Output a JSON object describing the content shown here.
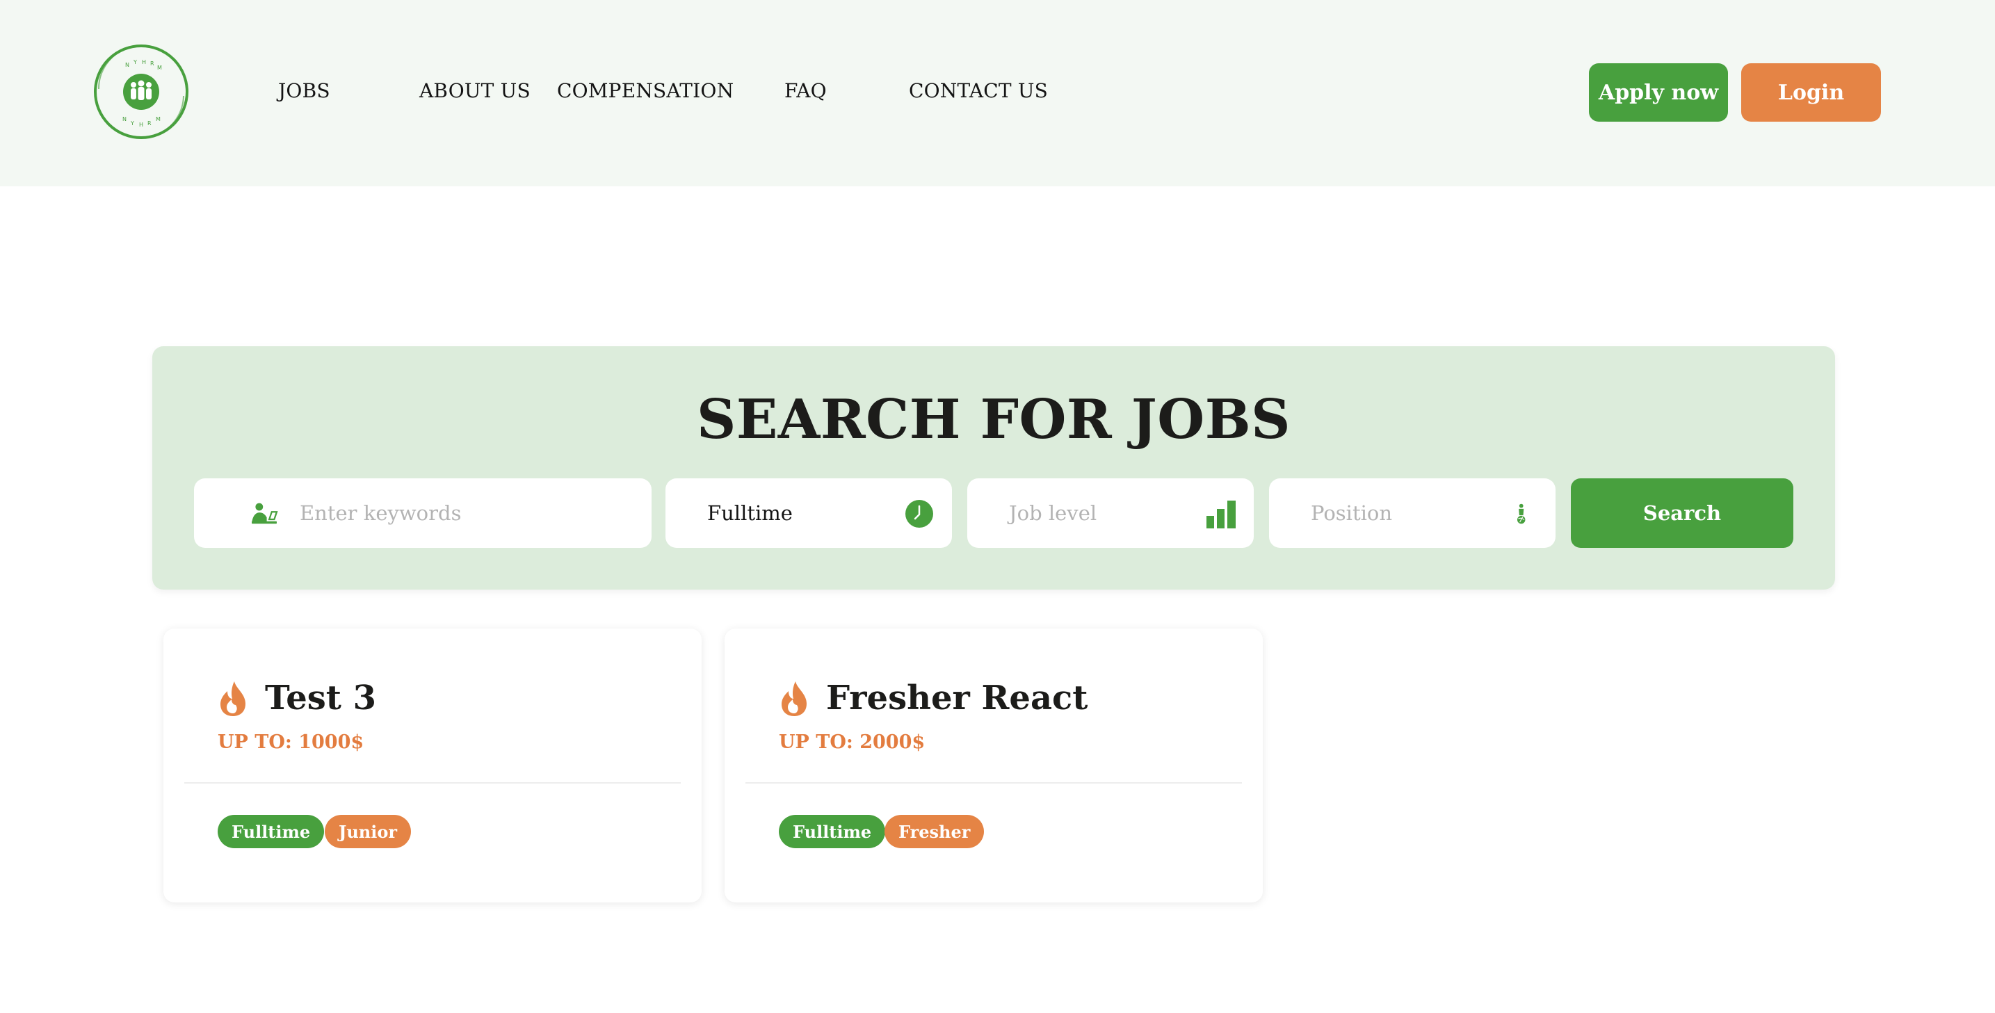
{
  "header": {
    "nav": [
      {
        "label": "JOBS"
      },
      {
        "label": "ABOUT US"
      },
      {
        "label": "COMPENSATION"
      },
      {
        "label": "FAQ"
      },
      {
        "label": "CONTACT US"
      }
    ],
    "apply_label": "Apply now",
    "login_label": "Login",
    "logo_icon": "people-circle-logo"
  },
  "search": {
    "title": "SEARCH FOR JOBS",
    "keywords_placeholder": "Enter keywords",
    "job_type_value": "Fulltime",
    "job_level_placeholder": "Job level",
    "position_placeholder": "Position",
    "button_label": "Search",
    "icons": [
      "user-laptop-icon",
      "clock-icon",
      "bar-chart-icon",
      "person-globe-icon"
    ]
  },
  "jobs": [
    {
      "title": "Test 3",
      "salary": "UP TO: 1000$",
      "tags": [
        {
          "label": "Fulltime",
          "color": "#48a03e"
        },
        {
          "label": "Junior",
          "color": "#e58445"
        }
      ]
    },
    {
      "title": "Fresher React",
      "salary": "UP TO: 2000$",
      "tags": [
        {
          "label": "Fulltime",
          "color": "#48a03e"
        },
        {
          "label": "Fresher",
          "color": "#e58445"
        }
      ]
    }
  ],
  "colors": {
    "brand_green": "#48a03e",
    "brand_orange": "#e58445",
    "header_bg": "#f3f8f3",
    "search_bg": "#dcecdb"
  }
}
